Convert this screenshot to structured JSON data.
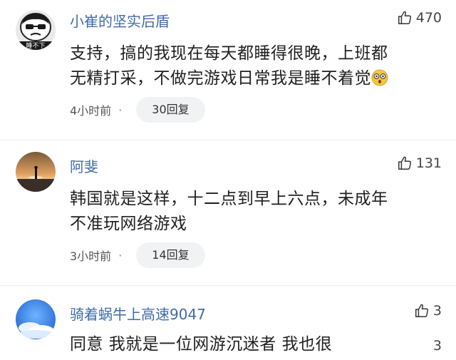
{
  "comments": [
    {
      "username": "小崔的坚实后盾",
      "likes": "470",
      "text_line1": "支持，搞的我现在每天都睡得很晚，上班都",
      "text_line2": "无精打采，不做完游戏日常我是睡不着觉",
      "time": "4小时前",
      "dot": "·",
      "replies": "30回复",
      "avatar_caption": "睡不下"
    },
    {
      "username": "阿斐",
      "likes": "131",
      "text_line1": "韩国就是这样，十二点到早上六点，未成年",
      "text_line2": "不准玩网络游戏",
      "time": "3小时前",
      "dot": "·",
      "replies": "14回复"
    },
    {
      "username": "骑着蜗牛上高速9047",
      "likes": "3",
      "text_line1": "同意 我就是一位网游沉迷者 我也很",
      "side_count": "3"
    }
  ],
  "colors": {
    "username": "#3f6ba8",
    "reply_pill_bg": "#f1f2f4"
  },
  "icons": [
    "avatar-cartoon",
    "avatar-sunset",
    "avatar-sky",
    "thumbs-up-icon",
    "astonished-emoji"
  ]
}
